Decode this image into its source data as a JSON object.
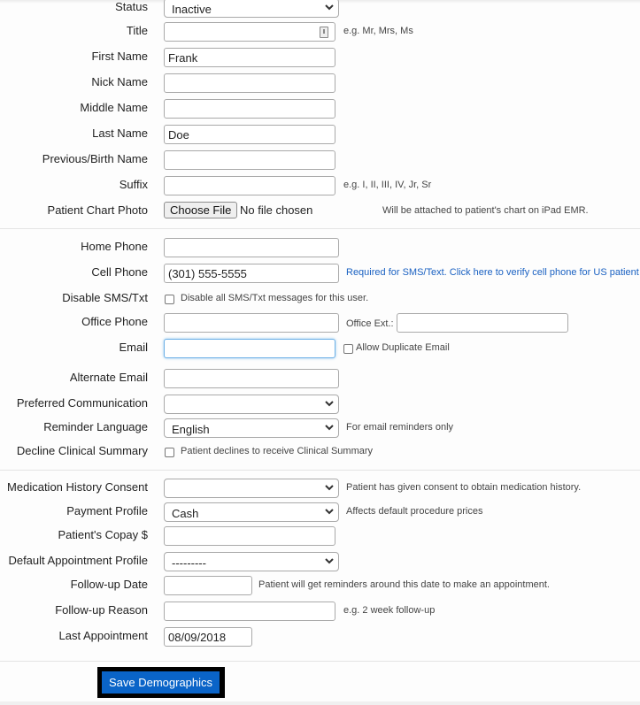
{
  "form": {
    "status": {
      "label": "Status",
      "value": "Inactive"
    },
    "title": {
      "label": "Title",
      "value": "",
      "hint": "e.g. Mr, Mrs, Ms"
    },
    "first_name": {
      "label": "First Name",
      "value": "Frank"
    },
    "nick_name": {
      "label": "Nick Name",
      "value": ""
    },
    "middle_name": {
      "label": "Middle Name",
      "value": ""
    },
    "last_name": {
      "label": "Last Name",
      "value": "Doe"
    },
    "previous_name": {
      "label": "Previous/Birth Name",
      "value": ""
    },
    "suffix": {
      "label": "Suffix",
      "value": "",
      "hint": "e.g. I, II, III, IV, Jr, Sr"
    },
    "chart_photo": {
      "label": "Patient Chart Photo",
      "button": "Choose File",
      "status": "No file chosen",
      "hint": "Will be attached to patient's chart on iPad EMR."
    },
    "home_phone": {
      "label": "Home Phone",
      "value": ""
    },
    "cell_phone": {
      "label": "Cell Phone",
      "value": "(301) 555-5555",
      "hint": "Required for SMS/Text. Click here to verify cell phone for US patient"
    },
    "disable_sms": {
      "label": "Disable SMS/Txt",
      "checkbox_label": "Disable all SMS/Txt messages for this user.",
      "checked": false
    },
    "office_phone": {
      "label": "Office Phone",
      "value": "",
      "ext_label": "Office Ext.:",
      "ext_value": ""
    },
    "email": {
      "label": "Email",
      "value": "",
      "checkbox_label": "Allow Duplicate Email",
      "checked": false
    },
    "alternate_email": {
      "label": "Alternate Email",
      "value": ""
    },
    "preferred_communication": {
      "label": "Preferred Communication",
      "value": ""
    },
    "reminder_language": {
      "label": "Reminder Language",
      "value": "English",
      "hint": "For email reminders only"
    },
    "decline_clinical_summary": {
      "label": "Decline Clinical Summary",
      "checkbox_label": "Patient declines to receive Clinical Summary",
      "checked": false
    },
    "medication_history_consent": {
      "label": "Medication History Consent",
      "value": "",
      "hint": "Patient has given consent to obtain medication history."
    },
    "payment_profile": {
      "label": "Payment Profile",
      "value": "Cash",
      "hint": "Affects default procedure prices"
    },
    "copay": {
      "label": "Patient's Copay $",
      "value": ""
    },
    "default_appointment_profile": {
      "label": "Default Appointment Profile",
      "value": "---------"
    },
    "followup_date": {
      "label": "Follow-up Date",
      "value": "",
      "hint": "Patient will get reminders around this date to make an appointment."
    },
    "followup_reason": {
      "label": "Follow-up Reason",
      "value": "",
      "hint": "e.g. 2 week follow-up"
    },
    "last_appointment": {
      "label": "Last Appointment",
      "value": "08/09/2018"
    }
  },
  "actions": {
    "save_label": "Save Demographics"
  },
  "colors": {
    "link": "#1a61c2",
    "primary_button": "#0a64c8",
    "focus_border": "#6cb0e6"
  }
}
